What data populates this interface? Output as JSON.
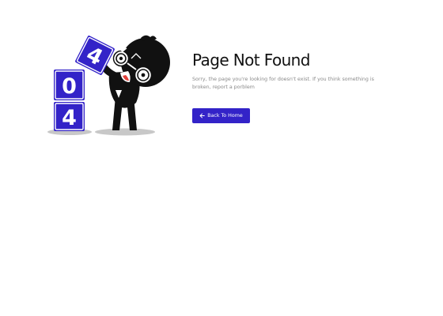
{
  "illustration": {
    "digits": [
      "4",
      "0",
      "4"
    ],
    "block_color": "#3323c8"
  },
  "content": {
    "title": "Page Not Found",
    "message": "Sorry, the page you're looking for doesn't exist. If you think something is broken, report a porblem",
    "button_label": "Back To Home",
    "button_icon": "arrow-left-icon",
    "accent_color": "#3323c8"
  }
}
